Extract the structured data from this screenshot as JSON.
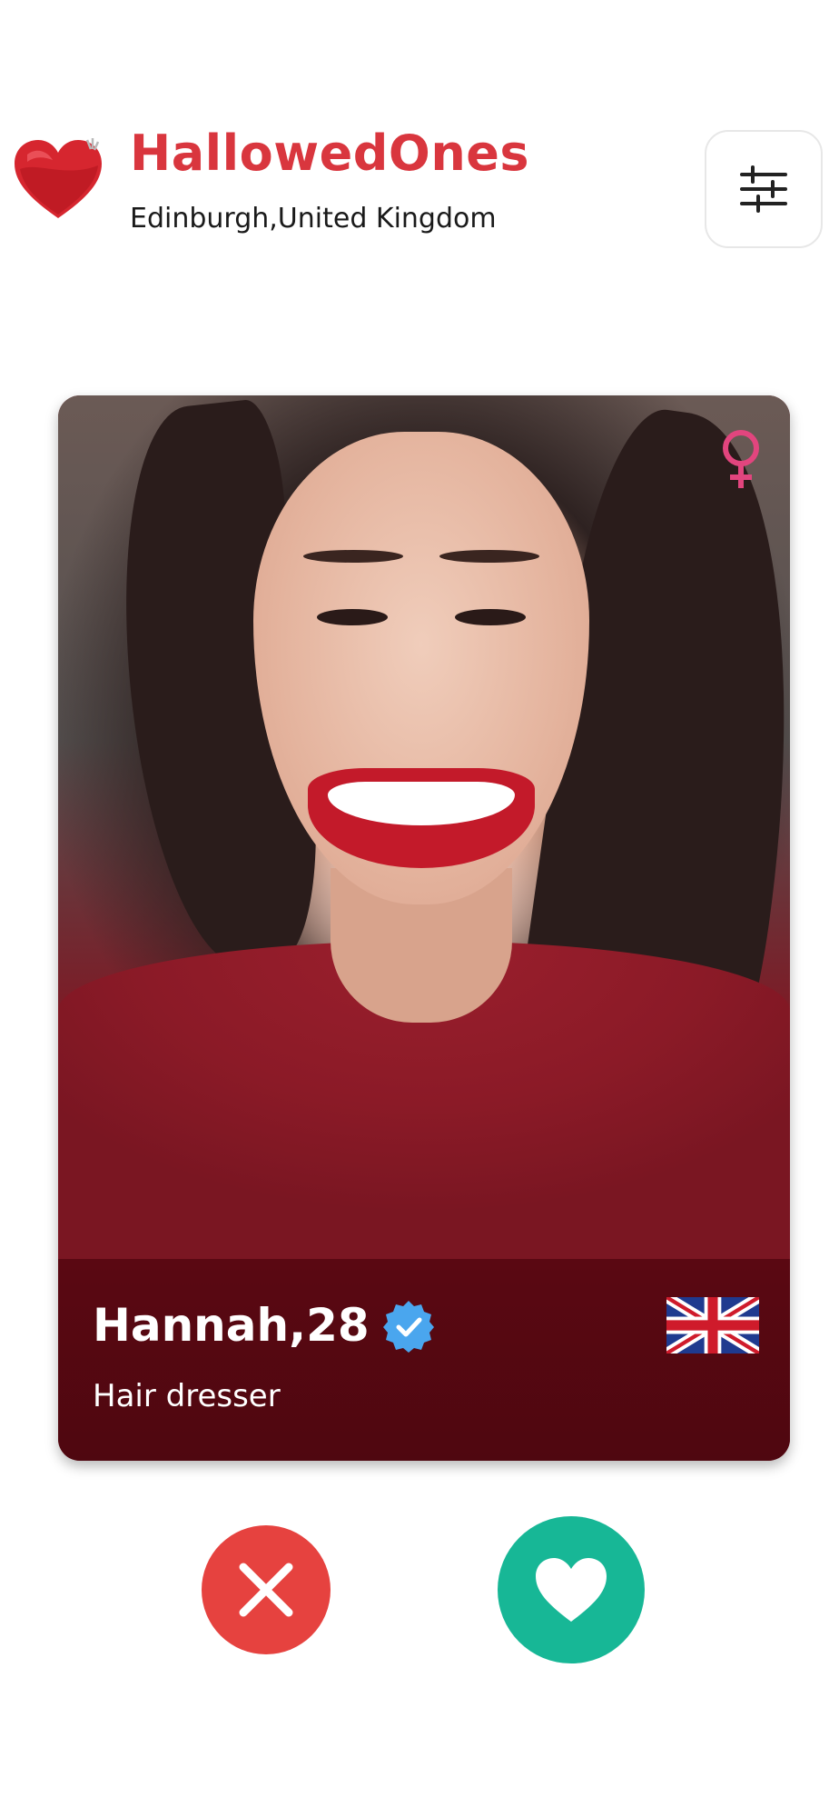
{
  "header": {
    "app_name": "HallowedOnes",
    "location": "Edinburgh,United Kingdom",
    "logo_icon": "heart-logo-icon",
    "filter_icon": "sliders-icon"
  },
  "profile_card": {
    "name_age": "Hannah,28",
    "occupation": "Hair dresser",
    "verified": true,
    "gender": "female",
    "country_flag": "united-kingdom-flag-icon"
  },
  "actions": {
    "dislike_icon": "close-icon",
    "like_icon": "heart-icon"
  },
  "colors": {
    "brand_red": "#d9363e",
    "dislike_red": "#e6423f",
    "like_green": "#17b796",
    "gender_pink": "#e2457e",
    "verified_blue": "#4aa6ee",
    "panel_dark_red": "#5a0812"
  }
}
